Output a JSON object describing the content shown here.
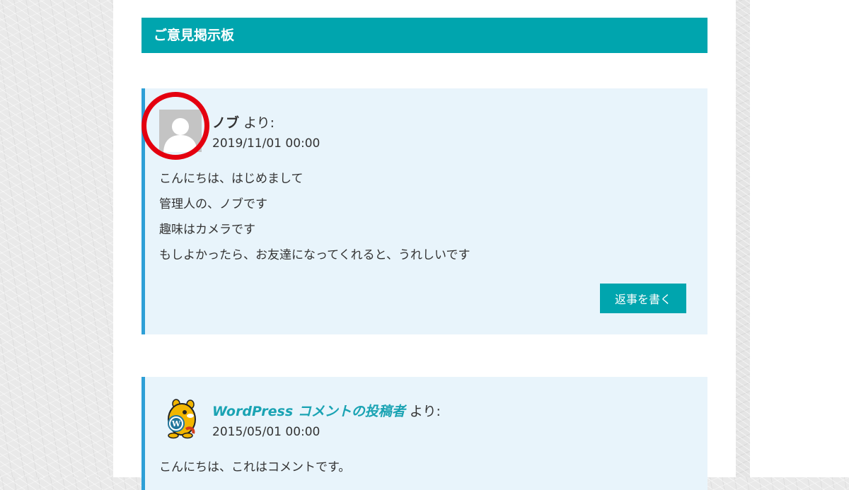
{
  "section": {
    "title": "ご意見掲示板"
  },
  "comments": [
    {
      "author": "ノブ",
      "suffix": "より:",
      "date": "2019/11/01 00:00",
      "lines": [
        "こんにちは、はじめまして",
        "管理人の、ノブです",
        "趣味はカメラです",
        "もしよかったら、お友達になってくれると、うれしいです"
      ],
      "reply_label": "返事を書く"
    },
    {
      "author": "WordPress コメントの投稿者",
      "suffix": "より:",
      "date": "2015/05/01 00:00",
      "lines": [
        "こんにちは、これはコメントです。"
      ]
    }
  ],
  "colors": {
    "accent": "#00a5ae",
    "comment_bg": "#e8f4fb",
    "comment_border": "#2e9fd6",
    "highlight": "#e4000f",
    "link": "#1aa3b3"
  }
}
